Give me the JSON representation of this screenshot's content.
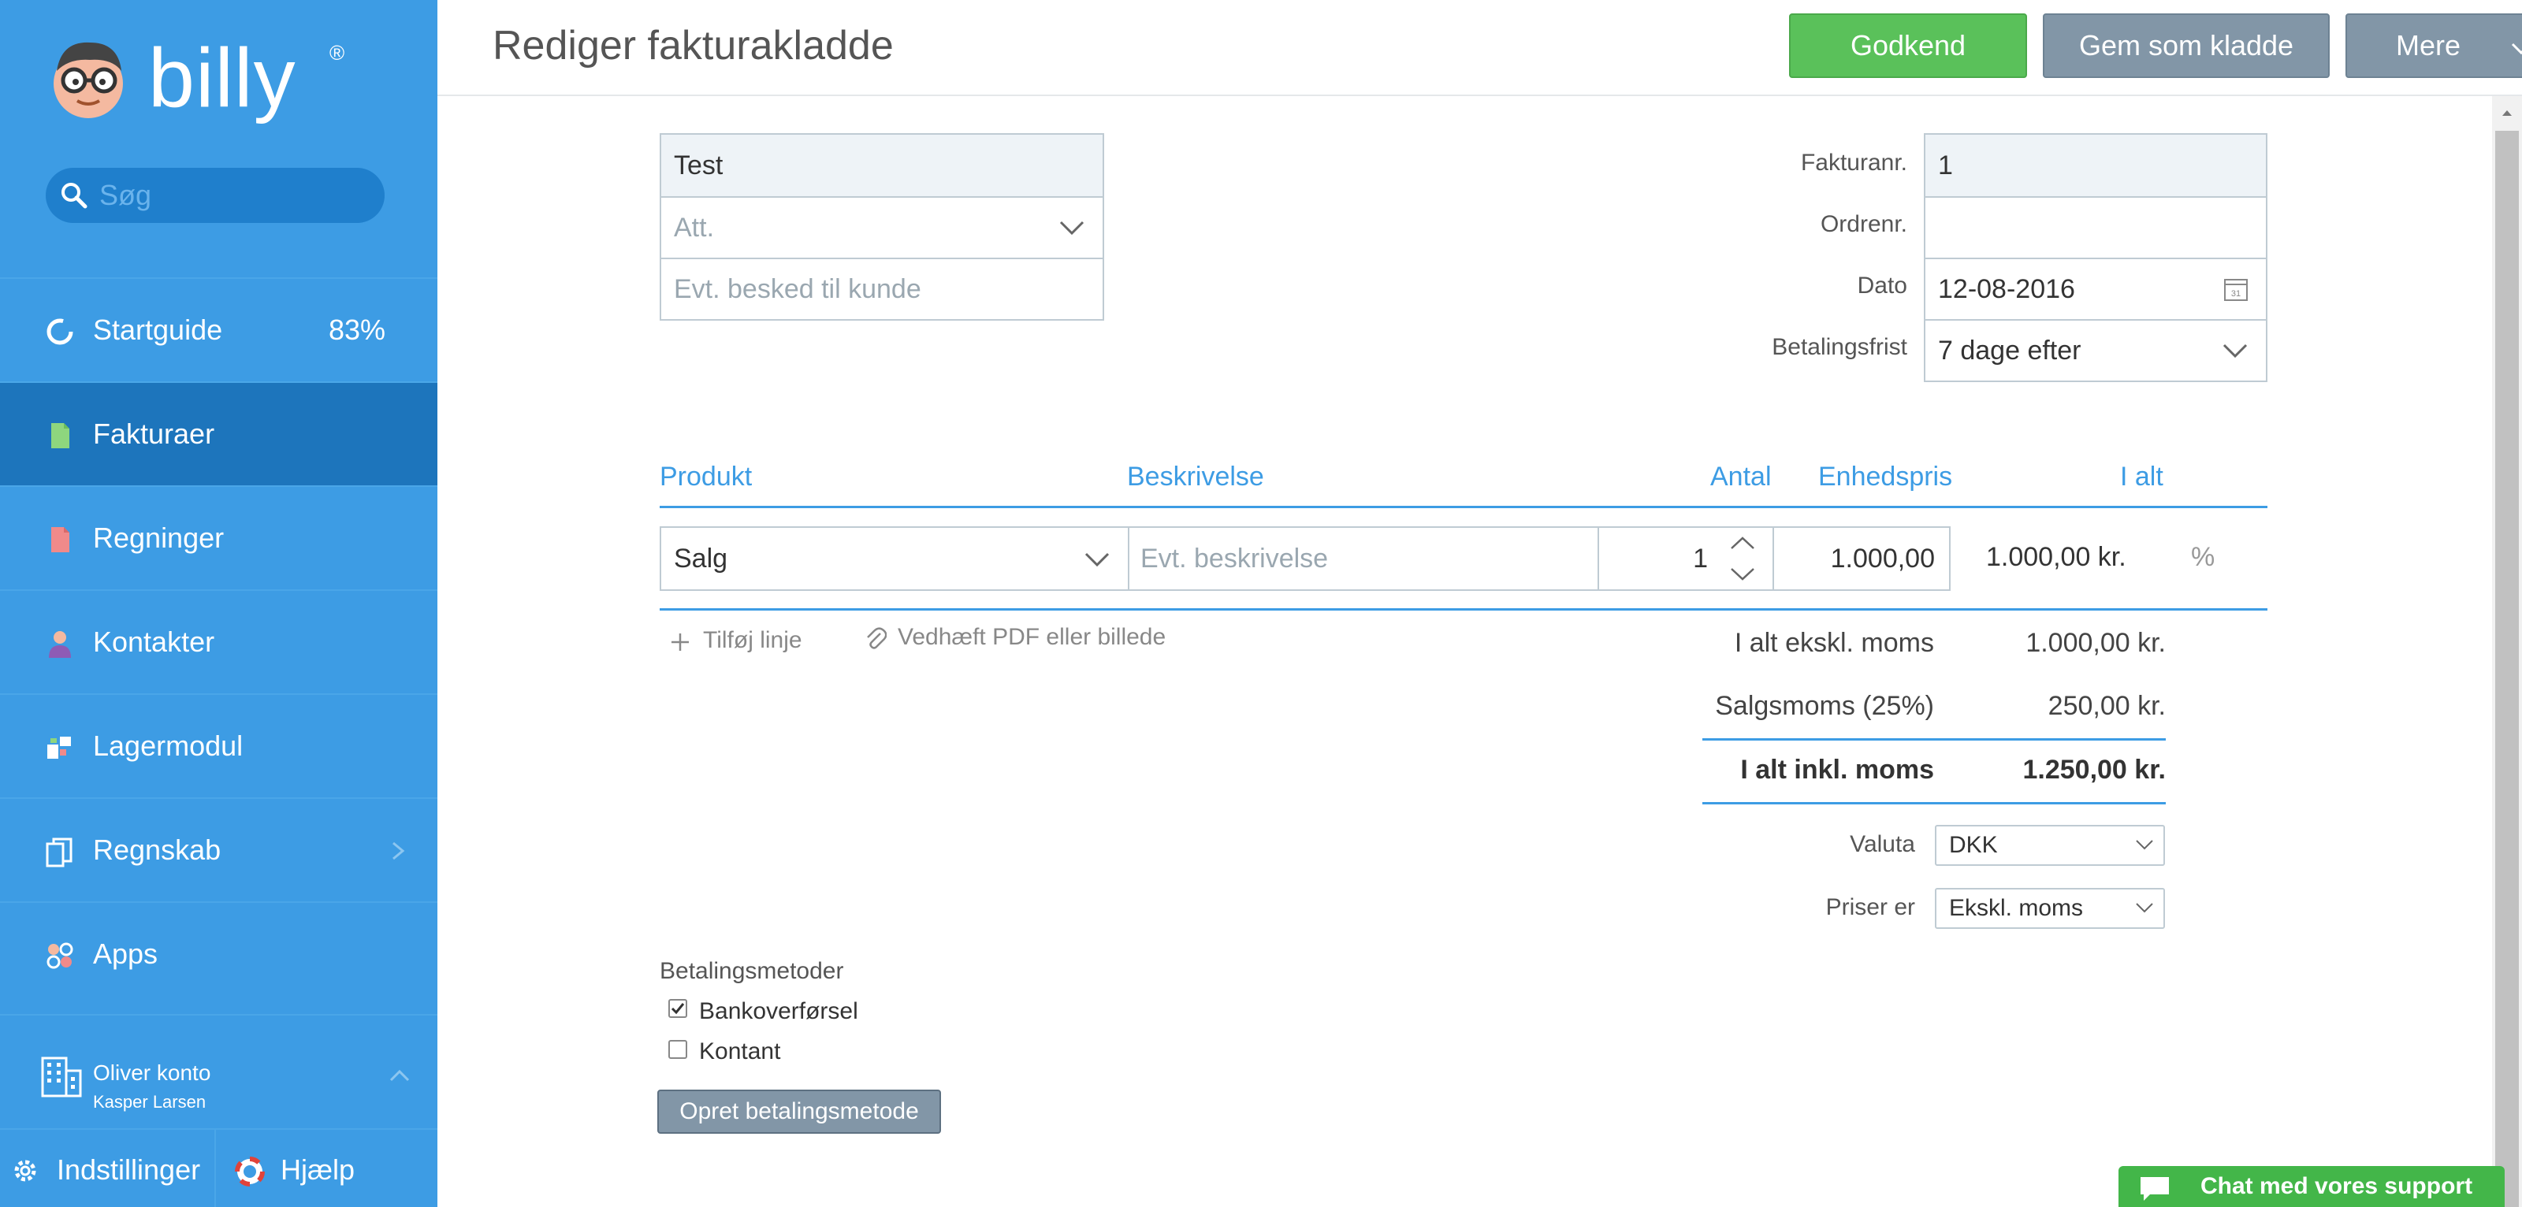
{
  "sidebar": {
    "logo_text": "billy",
    "logo_reg": "®",
    "search_placeholder": "Søg",
    "items": [
      {
        "label": "Startguide",
        "extra": "83%"
      },
      {
        "label": "Fakturaer"
      },
      {
        "label": "Regninger"
      },
      {
        "label": "Kontakter"
      },
      {
        "label": "Lagermodul"
      },
      {
        "label": "Regnskab"
      },
      {
        "label": "Apps"
      }
    ],
    "account_name": "Oliver konto",
    "account_user": "Kasper Larsen",
    "settings_label": "Indstillinger",
    "help_label": "Hjælp"
  },
  "header": {
    "title": "Rediger fakturakladde",
    "approve_label": "Godkend",
    "draft_label": "Gem som kladde",
    "more_label": "Mere"
  },
  "customer": {
    "name": "Test",
    "att_placeholder": "Att.",
    "message_placeholder": "Evt. besked til kunde"
  },
  "meta": {
    "invoice_no_label": "Fakturanr.",
    "invoice_no": "1",
    "order_no_label": "Ordrenr.",
    "order_no": "",
    "date_label": "Dato",
    "date": "12-08-2016",
    "calendar_day": "31",
    "due_label": "Betalingsfrist",
    "due": "7 dage efter"
  },
  "table": {
    "headers": {
      "product": "Produkt",
      "description": "Beskrivelse",
      "quantity": "Antal",
      "unit_price": "Enhedspris",
      "total": "I alt"
    },
    "row": {
      "product": "Salg",
      "description_placeholder": "Evt. beskrivelse",
      "quantity": "1",
      "unit_price": "1.000,00",
      "total": "1.000,00 kr.",
      "discount_symbol": "%"
    }
  },
  "actions": {
    "add_line": "Tilføj linje",
    "attach": "Vedhæft PDF eller billede"
  },
  "totals": {
    "excl_label": "I alt ekskl. moms",
    "excl_value": "1.000,00 kr.",
    "vat_label": "Salgsmoms (25%)",
    "vat_value": "250,00 kr.",
    "incl_label": "I alt inkl. moms",
    "incl_value": "1.250,00 kr."
  },
  "currency": {
    "label": "Valuta",
    "value": "DKK"
  },
  "prices": {
    "label": "Priser er",
    "value": "Ekskl. moms"
  },
  "payment": {
    "title": "Betalingsmetoder",
    "methods": [
      {
        "label": "Bankoverførsel",
        "checked": true
      },
      {
        "label": "Kontant",
        "checked": false
      }
    ],
    "create_label": "Opret betalingsmetode"
  },
  "chat": {
    "label": "Chat med vores support"
  },
  "colors": {
    "sidebar": "#3d9ce4",
    "sidebar_active": "#1d75bc",
    "accent": "#3d9ce4",
    "approve": "#5ac15a",
    "secondary_button": "#8296a7",
    "chat": "#43b649"
  }
}
